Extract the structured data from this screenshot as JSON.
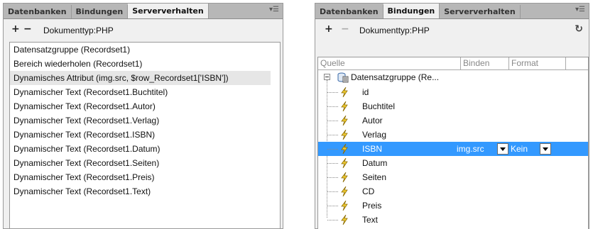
{
  "left_panel": {
    "tabs": [
      "Datenbanken",
      "Bindungen",
      "Serververhalten"
    ],
    "active_tab": "Serververhalten",
    "menu_icon": "panel-menu-icon",
    "toolbar": {
      "add_label": "+",
      "remove_label": "−",
      "doctype": "Dokumenttyp:PHP"
    },
    "server_behaviors": [
      "Datensatzgruppe (Recordset1)",
      "Bereich wiederholen (Recordset1)",
      "Dynamisches Attribut (img.src, $row_Recordset1['ISBN'])",
      "Dynamischer Text (Recordset1.Buchtitel)",
      "Dynamischer Text (Recordset1.Autor)",
      "Dynamischer Text (Recordset1.Verlag)",
      "Dynamischer Text (Recordset1.ISBN)",
      "Dynamischer Text (Recordset1.Datum)",
      "Dynamischer Text (Recordset1.Seiten)",
      "Dynamischer Text (Recordset1.Preis)",
      "Dynamischer Text (Recordset1.Text)"
    ],
    "selected_index": 2
  },
  "right_panel": {
    "tabs": [
      "Datenbanken",
      "Bindungen",
      "Serververhalten"
    ],
    "active_tab": "Bindungen",
    "menu_icon": "panel-menu-icon",
    "toolbar": {
      "add_label": "+",
      "remove_label": "−",
      "doctype": "Dokumenttyp:PHP",
      "refresh_icon": "refresh-icon"
    },
    "columns": [
      "Quelle",
      "Binden",
      "Format"
    ],
    "tree": {
      "root_label": "Datensatzgruppe (Re...",
      "root_icon": "recordset-icon",
      "field_icon": "lightning-bolt-icon",
      "fields": [
        "id",
        "Buchtitel",
        "Autor",
        "Verlag",
        "ISBN",
        "Datum",
        "Seiten",
        "CD",
        "Preis",
        "Text"
      ],
      "selected_field": "ISBN",
      "selected_binding": "img.src",
      "selected_format": "Kein"
    }
  },
  "colors": {
    "selection": "#3399ff",
    "left_selection": "#e6e6e6",
    "tabbar": "#b7b7b7",
    "panel": "#f0f0f0"
  }
}
